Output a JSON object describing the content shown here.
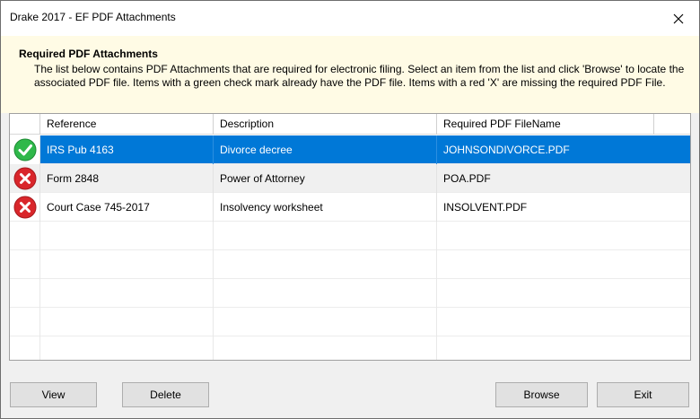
{
  "window": {
    "title": "Drake 2017 - EF PDF Attachments"
  },
  "header": {
    "title": "Required PDF Attachments",
    "description": "The list below contains PDF Attachments that are required for electronic filing. Select an item from the list and click 'Browse' to locate the associated PDF file. Items with a green check mark already have the PDF file. Items with a red 'X' are missing the required PDF File."
  },
  "table": {
    "columns": [
      "Reference",
      "Description",
      "Required PDF FileName"
    ],
    "rows": [
      {
        "status": "check-icon",
        "reference": "IRS Pub 4163",
        "description": "Divorce decree",
        "filename": "JOHNSONDIVORCE.PDF",
        "selected": true
      },
      {
        "status": "error-x-icon",
        "reference": "Form 2848",
        "description": "Power of Attorney",
        "filename": "POA.PDF",
        "selected": false
      },
      {
        "status": "error-x-icon",
        "reference": "Court Case 745-2017",
        "description": "Insolvency worksheet",
        "filename": "INSOLVENT.PDF",
        "selected": false
      }
    ]
  },
  "buttons": {
    "view": "View",
    "delete": "Delete",
    "browse": "Browse",
    "exit": "Exit"
  },
  "colors": {
    "selection": "#0078d7",
    "header_panel": "#fffbe5",
    "check_green": "#2fb84a",
    "error_red": "#d9262b"
  }
}
